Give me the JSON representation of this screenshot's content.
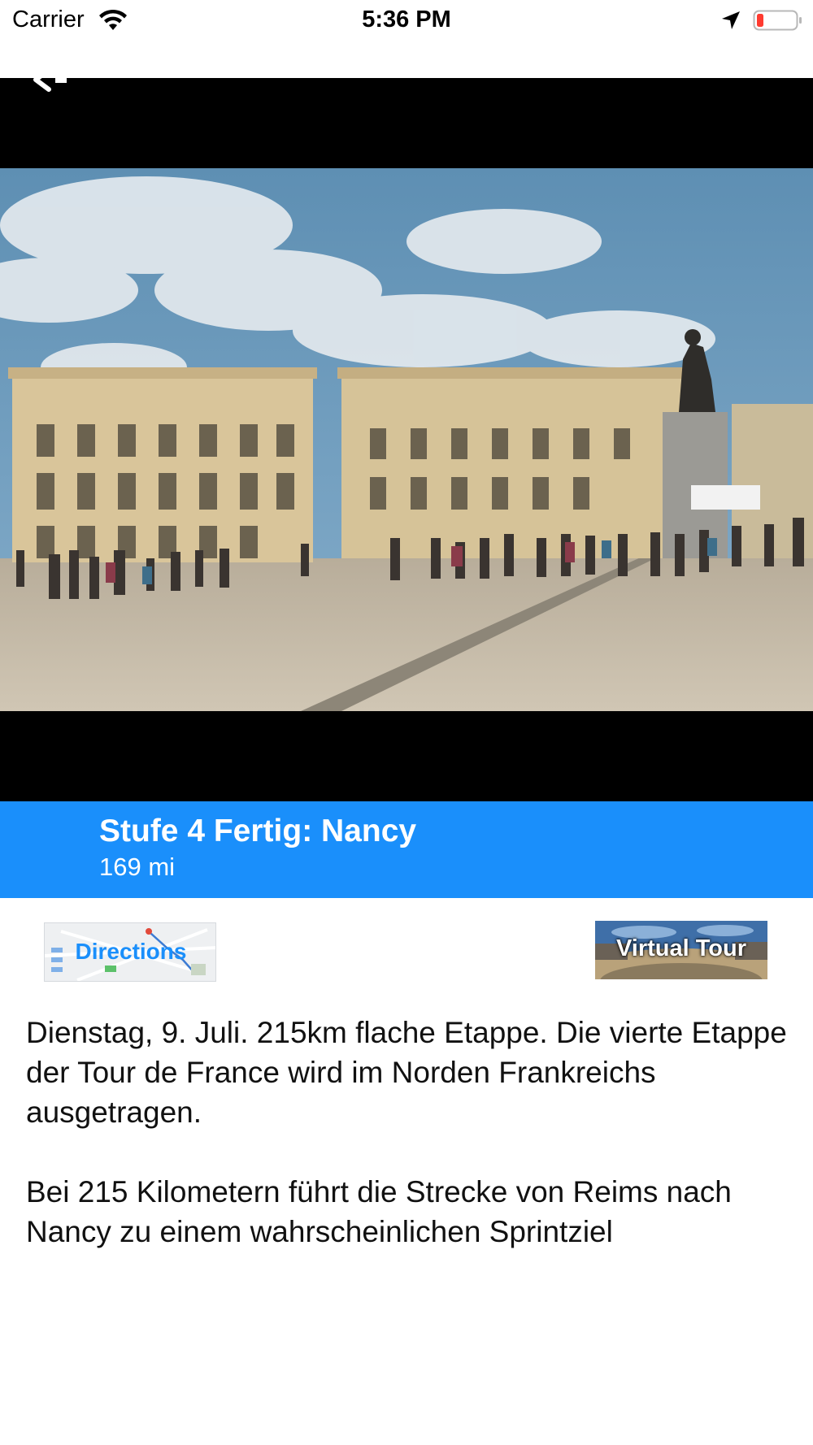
{
  "status_bar": {
    "carrier": "Carrier",
    "time": "5:36 PM",
    "wifi_icon": "wifi-icon",
    "location_icon": "location-arrow-icon",
    "battery_icon": "battery-low-icon",
    "battery_color": "#ff3b30"
  },
  "header": {
    "back_icon": "back-arrow-icon"
  },
  "stage": {
    "title": "Stufe 4 Fertig: Nancy",
    "distance": "169 mi",
    "banner_color": "#1a8ffb"
  },
  "actions": {
    "directions_label": "Directions",
    "virtual_tour_label": "Virtual Tour"
  },
  "description": {
    "paragraph_1": "Dienstag, 9. Juli. 215km flache Etappe. Die vierte Etappe der Tour de France wird im Norden Frankreichs ausgetragen.",
    "paragraph_2": "Bei 215 Kilometern führt die Strecke von Reims nach Nancy zu einem wahrscheinlichen Sprintziel"
  }
}
